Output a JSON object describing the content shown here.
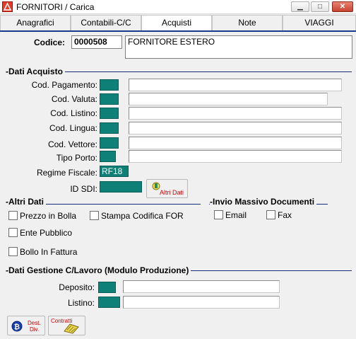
{
  "window": {
    "title": "FORNITORI / Carica",
    "minimize": "▁",
    "maximize": "□",
    "close": "✕"
  },
  "tabs": [
    "Anagrafici",
    "Contabili-C/C",
    "Acquisti",
    "Note",
    "VIAGGI"
  ],
  "header": {
    "code_label": "Codice:",
    "code_value": "0000508",
    "name_value": "FORNITORE ESTERO"
  },
  "dati_acquisto": {
    "title": "Dati Acquisto",
    "fields": [
      {
        "label": "Cod. Pagamento:",
        "code": "",
        "value": ""
      },
      {
        "label": "Cod. Valuta:",
        "code": "",
        "value": ""
      },
      {
        "label": "Cod. Listino:",
        "code": "",
        "value": ""
      },
      {
        "label": "Cod. Lingua:",
        "code": "",
        "value": ""
      },
      {
        "label": "Cod. Vettore:",
        "code": "",
        "value": ""
      },
      {
        "label": "Tipo Porto:",
        "code": "",
        "value": ""
      }
    ],
    "regime_label": "Regime Fiscale:",
    "regime_value": "RF18",
    "sdi_label": "ID SDI:",
    "sdi_value": "",
    "altri_dati_button": "Altri Dati"
  },
  "altri_dati": {
    "title": "Altri Dati",
    "checks": [
      "Prezzo in Bolla",
      "Stampa Codifica FOR",
      "Ente Pubblico",
      "Bollo In Fattura"
    ]
  },
  "invio_massivo": {
    "title": "Invio Massivo Documenti",
    "checks": [
      "Email",
      "Fax"
    ]
  },
  "gestione": {
    "title": "Dati Gestione C/Lavoro (Modulo Produzione)",
    "deposito_label": "Deposito:",
    "listino_label": "Listino:"
  },
  "bottom_buttons": {
    "dest_line1": "Dest.",
    "dest_line2": "Div.",
    "contratti": "Contratti"
  },
  "colors": {
    "teal": "#0f8078",
    "section_line": "#1a2d7a",
    "tab_underline": "#1a3a8a",
    "red_text": "#d40000"
  }
}
